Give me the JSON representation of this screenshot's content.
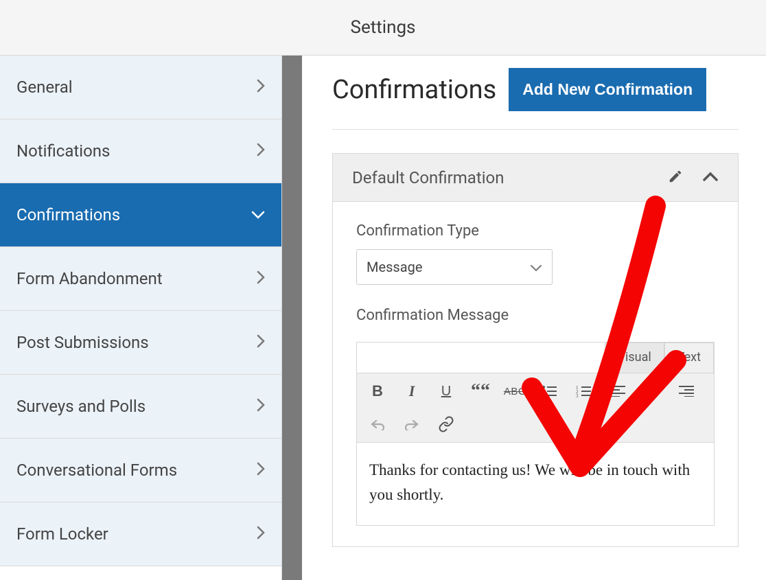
{
  "header": {
    "title": "Settings"
  },
  "sidebar": {
    "items": [
      {
        "label": "General",
        "active": false
      },
      {
        "label": "Notifications",
        "active": false
      },
      {
        "label": "Confirmations",
        "active": true
      },
      {
        "label": "Form Abandonment",
        "active": false
      },
      {
        "label": "Post Submissions",
        "active": false
      },
      {
        "label": "Surveys and Polls",
        "active": false
      },
      {
        "label": "Conversational Forms",
        "active": false
      },
      {
        "label": "Form Locker",
        "active": false
      }
    ]
  },
  "main": {
    "page_title": "Confirmations",
    "add_button": "Add New Confirmation",
    "panel": {
      "title": "Default Confirmation",
      "type_label": "Confirmation Type",
      "type_value": "Message",
      "message_label": "Confirmation Message",
      "editor": {
        "tab_visual": "Visual",
        "tab_text": "Text",
        "content": "Thanks for contacting us! We will be in touch with you shortly.",
        "buttons": {
          "bold": "B",
          "italic": "I",
          "underline": "U",
          "quote": "““",
          "strike": "ABC"
        }
      }
    }
  },
  "colors": {
    "accent": "#1a6cb0",
    "annotation": "#f40402"
  }
}
